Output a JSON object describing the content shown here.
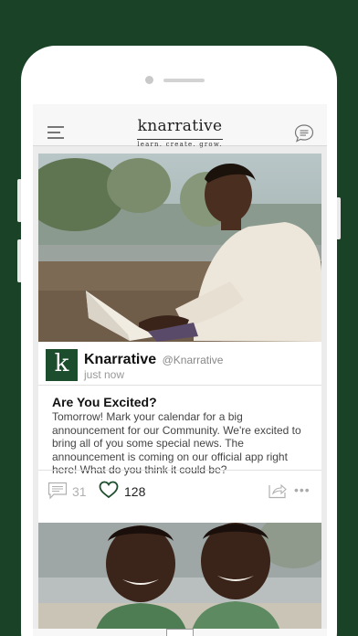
{
  "app": {
    "logo": "knarrative",
    "tagline": "learn. create. grow."
  },
  "icons": {
    "menu": "hamburger-menu-icon",
    "chat": "chat-bubble-icon",
    "comment": "comment-icon",
    "like": "heart-icon",
    "share": "share-icon",
    "more": "more-options-icon"
  },
  "colors": {
    "brand_green": "#1c4d2c",
    "background": "#1a4226"
  },
  "feed": {
    "post": {
      "avatar_letter": "k",
      "author_name": "Knarrative",
      "author_handle": "@Knarrative",
      "timestamp": "just now",
      "title": "Are You Excited?",
      "body": "Tomorrow! Mark your calendar for a big announcement for our Community. We're excited to bring all of you some special news. The announcement is coming on our official app right here! What do you think it could be?",
      "comment_count": "31",
      "like_count": "128",
      "more_glyph": "•••"
    }
  }
}
